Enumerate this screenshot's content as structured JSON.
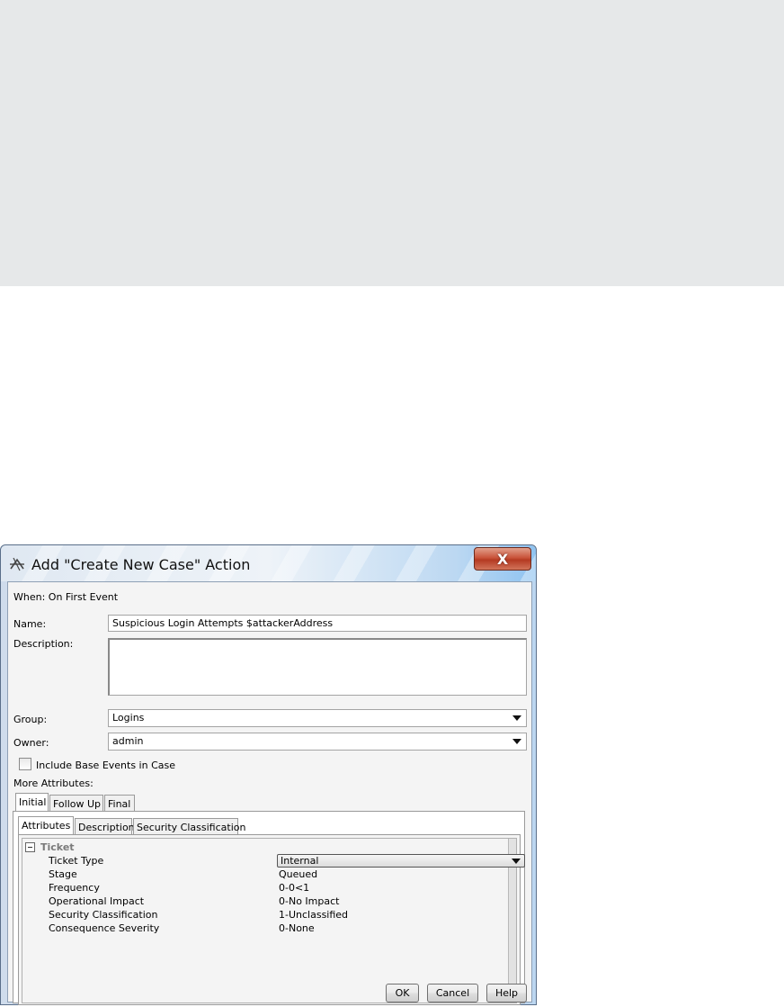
{
  "dialog": {
    "title": "Add \"Create New Case\" Action",
    "close_label": "X",
    "when": "When: On First Event",
    "name_label": "Name:",
    "name_value": "Suspicious Login Attempts $attackerAddress",
    "description_label": "Description:",
    "description_value": "",
    "group_label": "Group:",
    "group_value": "Logins",
    "owner_label": "Owner:",
    "owner_value": "admin",
    "include_base_events_label": "Include Base Events in Case",
    "include_base_events_checked": false,
    "more_attributes_label": "More Attributes:",
    "outer_tabs": [
      "Initial",
      "Follow Up",
      "Final"
    ],
    "inner_tabs": [
      "Attributes",
      "Description",
      "Security Classification"
    ],
    "group_header": "Ticket",
    "properties": [
      {
        "name": "Ticket Type",
        "value": "Internal"
      },
      {
        "name": "Stage",
        "value": "Queued"
      },
      {
        "name": "Frequency",
        "value": "0-0<1"
      },
      {
        "name": "Operational Impact",
        "value": "0-No Impact"
      },
      {
        "name": "Security Classification",
        "value": "1-Unclassified"
      },
      {
        "name": "Consequence Severity",
        "value": "0-None"
      }
    ],
    "buttons": {
      "ok": "OK",
      "cancel": "Cancel",
      "help": "Help"
    }
  },
  "colors": {
    "top_band": "#e6e8e9",
    "close_button": "#c9533a"
  }
}
